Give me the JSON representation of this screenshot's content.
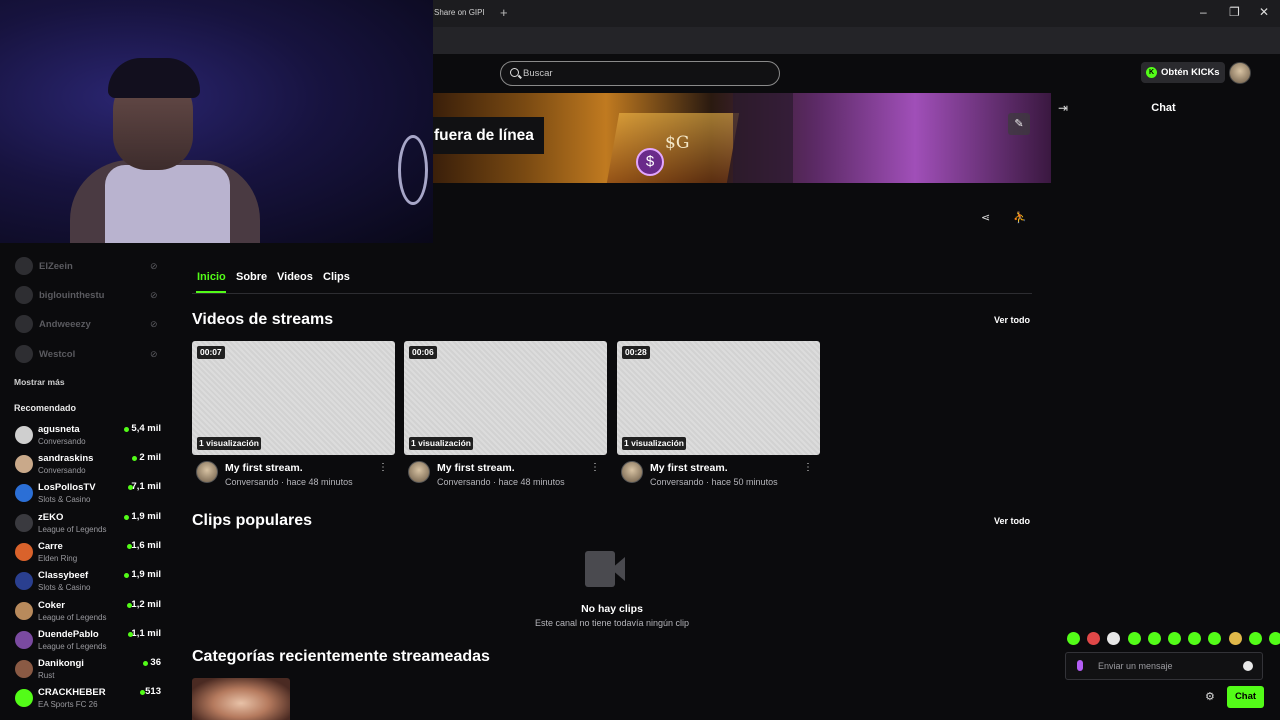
{
  "browser": {
    "tab_title": "Share on GIPI",
    "new_tab_label": "+",
    "win_min": "‒",
    "win_max": "❐",
    "win_close": "✕"
  },
  "header": {
    "search_placeholder": "Buscar",
    "kicks_button": "Obtén KICKs",
    "kicks_logo": "K"
  },
  "banner": {
    "offline_label": "fuera de línea",
    "coin": "$",
    "g_text": "$G"
  },
  "sidebar": {
    "followed_offline": [
      {
        "name": "ElZeein"
      },
      {
        "name": "biglouinthestu"
      },
      {
        "name": "Andweeezy"
      },
      {
        "name": "Westcol"
      }
    ],
    "show_more": "Mostrar más",
    "recommended_title": "Recomendado",
    "recommended": [
      {
        "name": "agusneta",
        "category": "Conversando",
        "viewers": "5,4 mil",
        "color": "#cfcfcf"
      },
      {
        "name": "sandraskins",
        "category": "Conversando",
        "viewers": "2 mil",
        "color": "#c9a98a"
      },
      {
        "name": "LosPollosTV",
        "category": "Slots & Casino",
        "viewers": "7,1 mil",
        "color": "#2b6fd6"
      },
      {
        "name": "zEKO",
        "category": "League of Legends",
        "viewers": "1,9 mil",
        "color": "#3a3a3f"
      },
      {
        "name": "Carre",
        "category": "Elden Ring",
        "viewers": "1,6 mil",
        "color": "#d9622b"
      },
      {
        "name": "Classybeef",
        "category": "Slots & Casino",
        "viewers": "1,9 mil",
        "color": "#2a3f8f"
      },
      {
        "name": "Coker",
        "category": "League of Legends",
        "viewers": "1,2 mil",
        "color": "#b88a5c"
      },
      {
        "name": "DuendePablo",
        "category": "League of Legends",
        "viewers": "1,1 mil",
        "color": "#7a4aa0"
      },
      {
        "name": "Danikongi",
        "category": "Rust",
        "viewers": "36",
        "color": "#8a5a44"
      },
      {
        "name": "CRACKHEBER",
        "category": "EA Sports FC 26",
        "viewers": "513",
        "color": "#53fc18"
      }
    ]
  },
  "tabs": [
    "Inicio",
    "Sobre",
    "Videos",
    "Clips"
  ],
  "videos_section": {
    "title": "Videos de streams",
    "see_all": "Ver todo",
    "items": [
      {
        "duration": "00:07",
        "views": "1 visualización",
        "title": "My first stream.",
        "meta": "Conversando · hace 48 minutos"
      },
      {
        "duration": "00:06",
        "views": "1 visualización",
        "title": "My first stream.",
        "meta": "Conversando · hace 48 minutos"
      },
      {
        "duration": "00:28",
        "views": "1 visualización",
        "title": "My first stream.",
        "meta": "Conversando · hace 50 minutos"
      }
    ]
  },
  "clips_section": {
    "title": "Clips populares",
    "see_all": "Ver todo",
    "empty_title": "No hay clips",
    "empty_subtitle": "Este canal no tiene todavía ningún clip"
  },
  "categories_section": {
    "title": "Categorías recientemente streameadas"
  },
  "chat": {
    "title": "Chat",
    "placeholder": "Enviar un mensaje",
    "send_label": "Chat",
    "emote_colors": [
      "#53fc18",
      "#e04848",
      "#e8e8e8",
      "#53fc18",
      "#53fc18",
      "#53fc18",
      "#53fc18",
      "#53fc18",
      "#e0b84a",
      "#53fc18",
      "#53fc18"
    ]
  }
}
